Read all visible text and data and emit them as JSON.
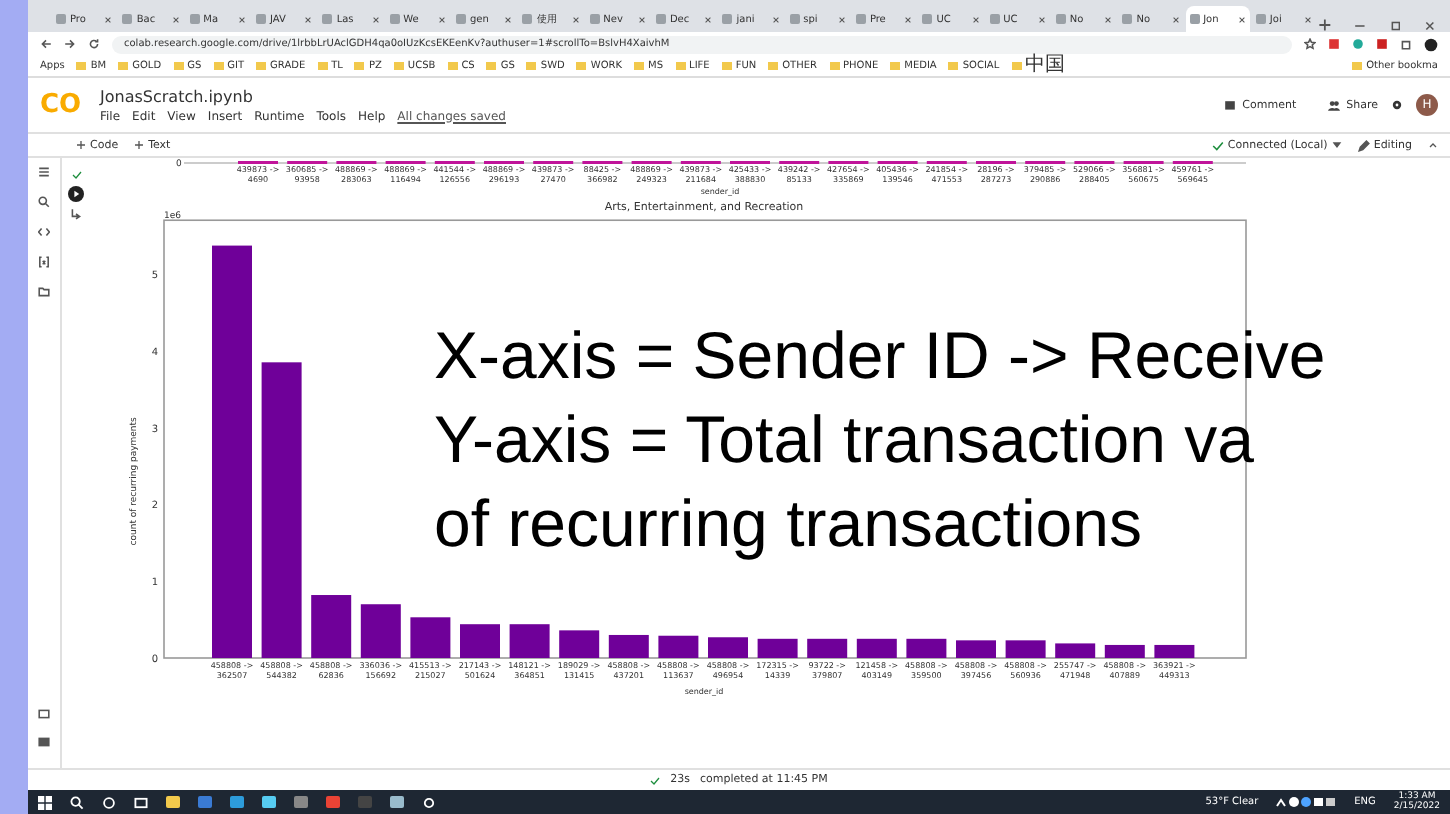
{
  "browser": {
    "tabs": [
      {
        "label": "Pro",
        "selected": false
      },
      {
        "label": "Bac",
        "selected": false
      },
      {
        "label": "Ma",
        "selected": false
      },
      {
        "label": "JAV",
        "selected": false
      },
      {
        "label": "Las",
        "selected": false
      },
      {
        "label": "We",
        "selected": false
      },
      {
        "label": "gen",
        "selected": false
      },
      {
        "label": "使用",
        "selected": false
      },
      {
        "label": "Nev",
        "selected": false
      },
      {
        "label": "Dec",
        "selected": false
      },
      {
        "label": "jani",
        "selected": false
      },
      {
        "label": "spi",
        "selected": false
      },
      {
        "label": "Pre",
        "selected": false
      },
      {
        "label": "UC",
        "selected": false
      },
      {
        "label": "UC",
        "selected": false
      },
      {
        "label": "No",
        "selected": false
      },
      {
        "label": "No",
        "selected": false
      },
      {
        "label": "Jon",
        "selected": true
      },
      {
        "label": "Joi",
        "selected": false
      }
    ],
    "address": "colab.research.google.com/drive/1lrbbLrUAclGDH4qa0oIUzKcsEKEenKv?authuser=1#scrollTo=BslvH4XaivhM",
    "bookmarks": [
      "Apps",
      "BM",
      "GOLD",
      "GS",
      "GIT",
      "GRADE",
      "TL",
      "PZ",
      "UCSB",
      "CS",
      "GS",
      "SWD",
      "WORK",
      "MS",
      "LIFE",
      "FUN",
      "OTHER",
      "PHONE",
      "MEDIA",
      "SOCIAL",
      "中国"
    ],
    "other_bookmarks": "Other bookma"
  },
  "notebook": {
    "logo": "CO",
    "title": "JonasScratch.ipynb",
    "menu": [
      "File",
      "Edit",
      "View",
      "Insert",
      "Runtime",
      "Tools",
      "Help"
    ],
    "save_status": "All changes saved",
    "actions": [
      "Comment",
      "Share"
    ],
    "avatar": "H",
    "toolbar": {
      "add_buttons": [
        "Code",
        "Text"
      ],
      "runtime": "Connected (Local)",
      "mode": "Editing"
    }
  },
  "output": {
    "previous_chart": {
      "zero_tick": "0",
      "xlabel": "sender_id",
      "categories": [
        "439873 ->\n4690",
        "360685 ->\n93958",
        "488869 ->\n283063",
        "488869 ->\n116494",
        "441544 ->\n126556",
        "488869 ->\n296193",
        "439873 ->\n27470",
        "88425 ->\n366982",
        "488869 ->\n249323",
        "439873 ->\n211684",
        "425433 ->\n388830",
        "439242 ->\n85133",
        "427654 ->\n335869",
        "405436 ->\n139546",
        "241854 ->\n471553",
        "28196 ->\n287273",
        "379485 ->\n290886",
        "529066 ->\n288405",
        "356881 ->\n560675",
        "459761 ->\n569645"
      ]
    },
    "chart": {
      "scale_label": "1e6",
      "chart_data": {
        "type": "bar",
        "title": "Arts, Entertainment, and Recreation",
        "xlabel": "sender_id",
        "ylabel": "count of recurring payments",
        "categories": [
          "458808 ->\n362507",
          "458808 ->\n544382",
          "458808 ->\n62836",
          "336036 ->\n156692",
          "415513 ->\n215027",
          "217143 ->\n501624",
          "148121 ->\n364851",
          "189029 ->\n131415",
          "458808 ->\n437201",
          "458808 ->\n113637",
          "458808 ->\n496954",
          "172315 ->\n14339",
          "93722 ->\n379807",
          "121458 ->\n403149",
          "458808 ->\n359500",
          "458808 ->\n397456",
          "458808 ->\n560936",
          "255747 ->\n471948",
          "458808 ->\n407889",
          "363921 ->\n449313"
        ],
        "series": [
          {
            "color": "#6f0099",
            "values": [
              5.37,
              3.85,
              0.82,
              0.7,
              0.53,
              0.44,
              0.44,
              0.36,
              0.3,
              0.29,
              0.27,
              0.25,
              0.25,
              0.25,
              0.25,
              0.23,
              0.23,
              0.19,
              0.17,
              0.17
            ]
          }
        ],
        "ylim": [
          0,
          5.7
        ],
        "yticks": [
          0,
          1,
          2,
          3,
          4,
          5
        ]
      }
    },
    "annotation": [
      "X-axis = Sender ID -> Receive",
      "Y-axis = Total transaction va",
      "of recurring transactions"
    ]
  },
  "status_bar": {
    "duration": "23s",
    "message": "completed at 11:45 PM"
  },
  "taskbar": {
    "weather": "53°F Clear",
    "language": "ENG",
    "time": "1:33 AM",
    "date": "2/15/2022"
  }
}
